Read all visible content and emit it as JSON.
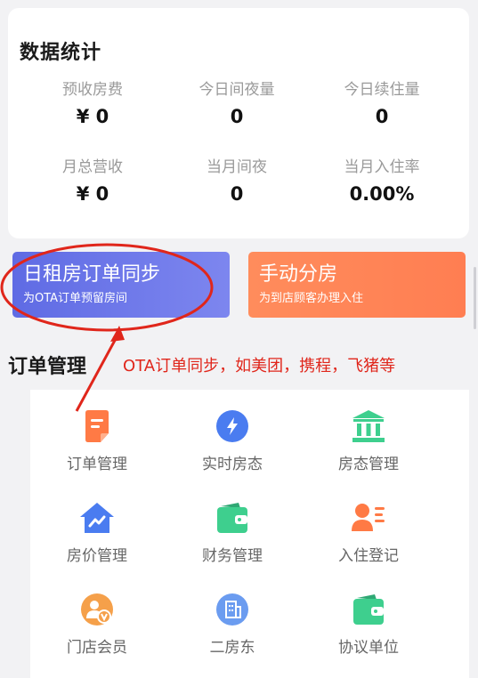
{
  "stats": {
    "title": "数据统计",
    "items": [
      {
        "label": "预收房费",
        "value": "¥ 0"
      },
      {
        "label": "今日间夜量",
        "value": "0"
      },
      {
        "label": "今日续住量",
        "value": "0"
      },
      {
        "label": "月总营收",
        "value": "¥ 0"
      },
      {
        "label": "当月间夜",
        "value": "0"
      },
      {
        "label": "当月入住率",
        "value": "0.00%"
      }
    ]
  },
  "actions": {
    "sync": {
      "title": "日租房订单同步",
      "subtitle": "为OTA订单预留房间",
      "color": "#6a74e8"
    },
    "assign": {
      "title": "手动分房",
      "subtitle": "为到店顾客办理入住",
      "color": "#ff8a5a"
    }
  },
  "annotation": {
    "text": "OTA订单同步，如美团，携程，飞猪等",
    "color": "#e0261b"
  },
  "orders": {
    "title": "订单管理",
    "items": [
      {
        "label": "订单管理",
        "icon": "document-icon",
        "color": "#ff7a45"
      },
      {
        "label": "实时房态",
        "icon": "lightning-icon",
        "color": "#4a7cf0"
      },
      {
        "label": "房态管理",
        "icon": "bank-icon",
        "color": "#3ecf8e"
      },
      {
        "label": "房价管理",
        "icon": "trend-chart-icon",
        "color": "#4a7cf0"
      },
      {
        "label": "财务管理",
        "icon": "wallet-icon",
        "color": "#3ecf8e"
      },
      {
        "label": "入住登记",
        "icon": "user-card-icon",
        "color": "#ff7a45"
      },
      {
        "label": "门店会员",
        "icon": "vip-member-icon",
        "color": "#f5a04a"
      },
      {
        "label": "二房东",
        "icon": "building-icon",
        "color": "#6b9cf0"
      },
      {
        "label": "协议单位",
        "icon": "wallet-icon",
        "color": "#3ecf8e"
      }
    ]
  }
}
